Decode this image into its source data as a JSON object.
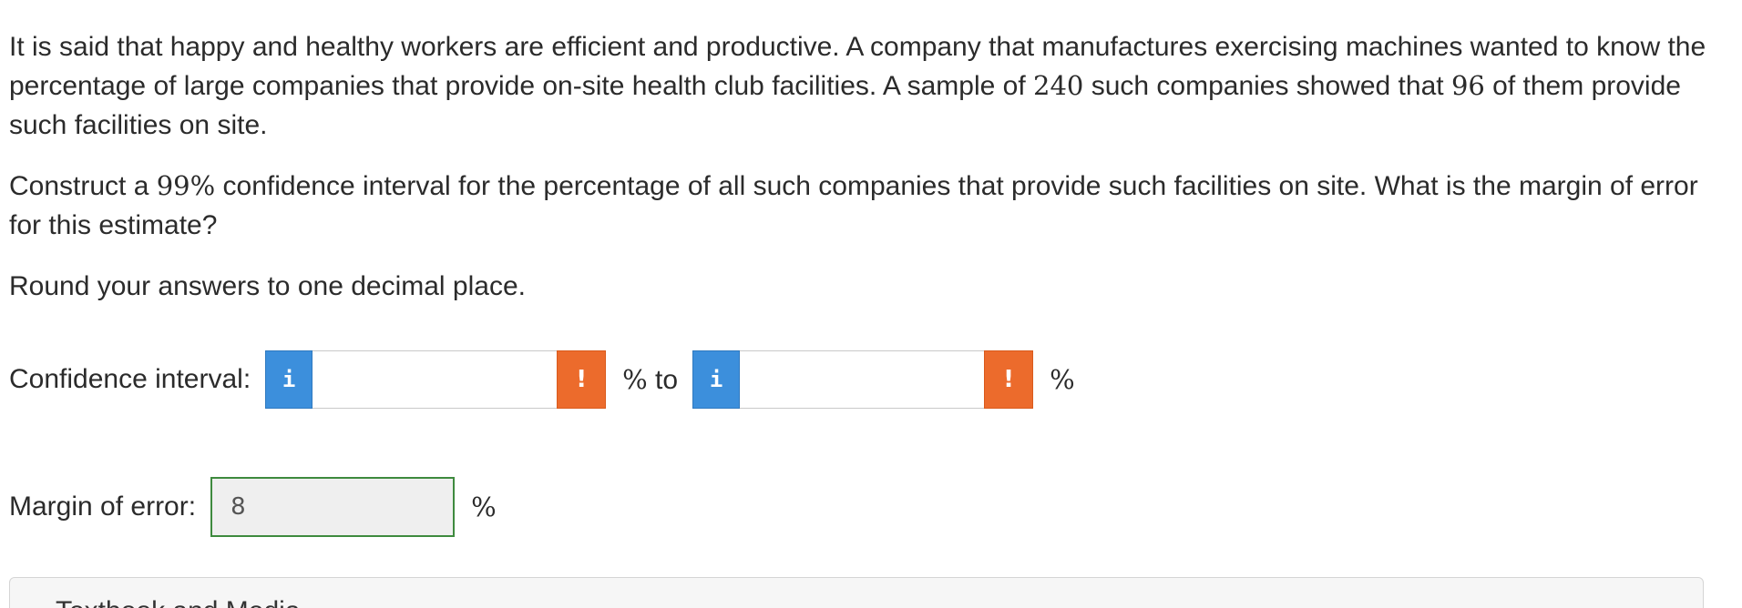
{
  "question": {
    "p1_a": "It is said that happy and healthy workers are efficient and productive. A company that manufactures exercising machines wanted to know the percentage of large companies that provide on-site health club facilities. A sample of ",
    "p1_n": "240",
    "p1_b": " such companies showed that ",
    "p1_x": "96",
    "p1_c": " of them provide such facilities on site.",
    "p2_a": "Construct a ",
    "p2_conf": "99%",
    "p2_b": " confidence interval for the percentage of all such companies that provide such facilities on site. What is the margin of error for this estimate?",
    "p3": "Round your answers to one decimal place."
  },
  "confidence_interval": {
    "label": "Confidence interval:",
    "info_glyph": "i",
    "warn_glyph": "!",
    "lower_value": "",
    "upper_value": "",
    "percent": "%",
    "to_text": " to"
  },
  "margin_of_error": {
    "label": "Margin of error:",
    "value": "8",
    "percent": "%"
  },
  "panel": {
    "title": "Textbook and Media"
  },
  "colors": {
    "info_button": "#3c8fdc",
    "warning_button": "#ec6b2c",
    "correct_border": "#3e8a3e"
  },
  "icons": {
    "info": "info-icon",
    "warning": "exclamation-icon"
  }
}
